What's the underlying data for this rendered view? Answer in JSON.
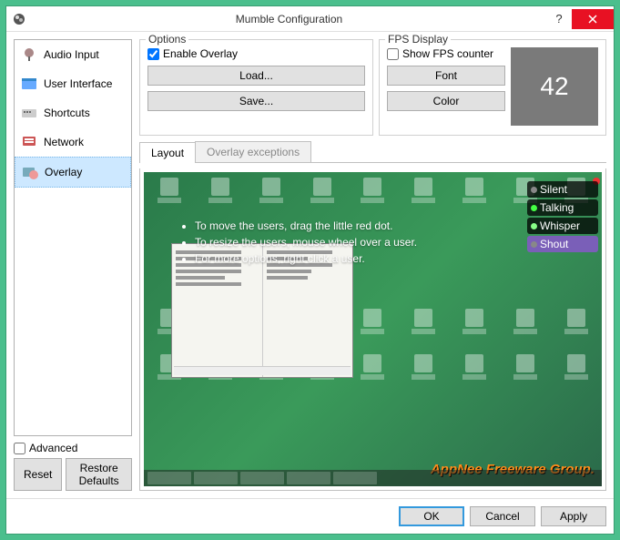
{
  "title": "Mumble Configuration",
  "sidebar": {
    "items": [
      {
        "label": "Audio Input"
      },
      {
        "label": "User Interface"
      },
      {
        "label": "Shortcuts"
      },
      {
        "label": "Network"
      },
      {
        "label": "Overlay"
      }
    ]
  },
  "advanced_label": "Advanced",
  "reset_label": "Reset",
  "restore_label": "Restore Defaults",
  "options": {
    "legend": "Options",
    "enable_label": "Enable Overlay",
    "load_label": "Load...",
    "save_label": "Save..."
  },
  "fps": {
    "legend": "FPS Display",
    "show_label": "Show FPS counter",
    "font_label": "Font",
    "color_label": "Color",
    "preview_value": "42"
  },
  "tabs": {
    "layout": "Layout",
    "exceptions": "Overlay exceptions"
  },
  "instructions": {
    "line1": "To move the users, drag the little red dot.",
    "line2": "To resize the users, mouse wheel over a user.",
    "line3": "For more options, right click a user."
  },
  "overlay_users": [
    {
      "name": "Silent"
    },
    {
      "name": "Talking"
    },
    {
      "name": "Whisper"
    },
    {
      "name": "Shout"
    }
  ],
  "watermark": "AppNee Freeware Group.",
  "footer": {
    "ok": "OK",
    "cancel": "Cancel",
    "apply": "Apply"
  }
}
